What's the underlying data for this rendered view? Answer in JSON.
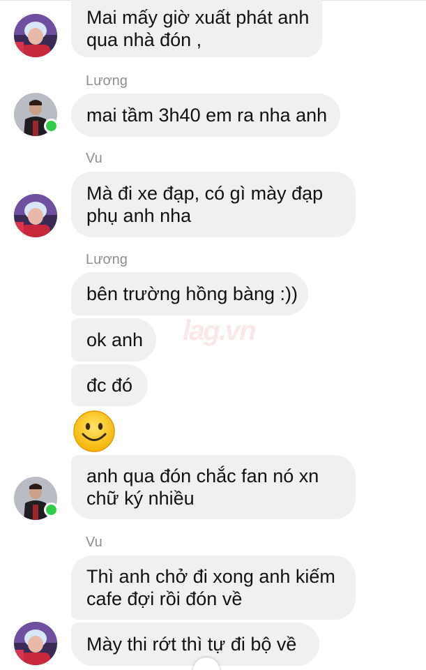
{
  "colors": {
    "bubble_bg": "#f1f0f0",
    "text": "#111111",
    "sender_name": "#8e8e8e",
    "online": "#31cc46"
  },
  "messages": [
    {
      "lines": [
        "Mai mấy giờ xuất phát anh",
        "qua nhà đón ,"
      ]
    },
    {
      "lines": [
        "mai tầm 3h40 em ra nha anh"
      ]
    },
    {
      "lines": [
        "Mà đi xe đạp, có gì mày đạp",
        "phụ anh nha"
      ]
    },
    {
      "lines": [
        "bên trường hồng bàng :))"
      ]
    },
    {
      "lines": [
        "ok anh"
      ]
    },
    {
      "lines": [
        "đc đó"
      ]
    },
    {
      "lines": [
        "anh qua đón chắc fan nó xn",
        "chữ ký nhiều"
      ]
    },
    {
      "lines": [
        "Thì anh chở đi xong anh kiếm",
        "cafe đợi rồi đón về"
      ]
    },
    {
      "lines": [
        "Mày thi rớt thì tự đi bộ về"
      ]
    }
  ],
  "senders": [
    "Lương",
    "Vu",
    "Lương",
    "Vu"
  ],
  "emoji": "smiling-face-emoji",
  "watermark": "lag.vn"
}
